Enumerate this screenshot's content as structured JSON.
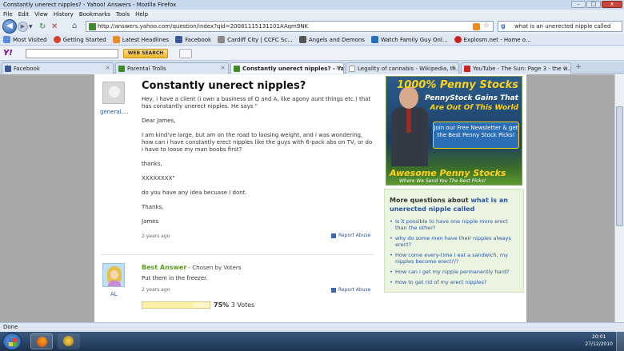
{
  "window": {
    "title": "Constantly unerect nipples? - Yahoo! Answers - Mozilla Firefox",
    "minimize": "–",
    "maximize": "□",
    "close": "x"
  },
  "menu": [
    "File",
    "Edit",
    "View",
    "History",
    "Bookmarks",
    "Tools",
    "Help"
  ],
  "nav": {
    "url": "http://answers.yahoo.com/question/index?qid=20081115131101AAqm9NK",
    "search_value": "what is an unerected nipple called"
  },
  "bookmarks": [
    {
      "label": "Most Visited",
      "color": "#5a8ad8"
    },
    {
      "label": "Getting Started",
      "color": "#d8402a"
    },
    {
      "label": "Latest Headlines",
      "color": "#f28a1a"
    },
    {
      "label": "Facebook",
      "color": "#3b5998"
    },
    {
      "label": "Cardiff City | CCFC Sc...",
      "color": "#888888"
    },
    {
      "label": "Angels and Demons",
      "color": "#555555"
    },
    {
      "label": "Watch Family Guy Onl...",
      "color": "#2a6fb5"
    },
    {
      "label": "Explosm.net - Home o...",
      "color": "#cc2222"
    }
  ],
  "yahoo_toolbar": {
    "logo": "Y!",
    "web_search": "WEB SEARCH"
  },
  "tabs": [
    {
      "label": "Facebook",
      "color": "#3b5998",
      "active": false
    },
    {
      "label": "Parental Trolls",
      "color": "#3f8a2b",
      "active": false
    },
    {
      "label": "Constantly unerect nipples? - Yah...",
      "color": "#3f8a2b",
      "active": true
    },
    {
      "label": "Legality of cannabis - Wikipedia, th...",
      "color": "#ffffff",
      "active": false
    },
    {
      "label": "YouTube - The Sun: Page 3 - the w...",
      "color": "#cc2222",
      "active": false
    }
  ],
  "tab_new": "+",
  "question": {
    "user": "general....",
    "title": "Constantly unerect nipples?",
    "body": [
      "Hey, i have a client (i own a business of Q and A, like agony aunt things etc.) that has constantly unerect nipples. He says \"",
      "Dear James,",
      "I am kind've large, but am on the road to loosing weight, and i was wondering, how can i have constantly erect nipples like the guys with 6-pack abs on TV, or do i have to loose my man boobs first?",
      "thanks,",
      "XXXXXXXX\"",
      "do you have any idea becuase I dont.",
      "Thanks,",
      "James"
    ],
    "time": "2 years ago",
    "report": "Report Abuse"
  },
  "answer": {
    "user": "AL",
    "best_label": "Best Answer",
    "chosen_by": " - Chosen by Voters",
    "body": "Put them in the freezer.",
    "time": "2 years ago",
    "report": "Report Abuse",
    "vote_percent_text": "75%",
    "vote_count_text": "3 Votes",
    "vote_fraction": 0.75
  },
  "ad": {
    "line1": "1000% Penny Stocks",
    "line2": "PennyStock Gains That",
    "line3": "Are Out Of This World",
    "button": "Join our Free Newsletter & get the Best Penny Stock Picks!",
    "logo": "Awesome Penny Stocks",
    "tagline": "Where We Send You The Best Picks!"
  },
  "more_questions": {
    "title_prefix": "More questions about ",
    "title_highlight": "what is an unerected nipple called",
    "items": [
      "Is it possible to have one nipple more erect than the other?",
      "why do some men have their nipples always erect?",
      "How come every-time I eat a sandwich, my nipples become erect?/?",
      "How can i get my nipple permanently hard?",
      "How to get rid of my erect nipples?"
    ]
  },
  "status": "Done",
  "taskbar": {
    "time": "20:01",
    "date": "27/12/2010"
  }
}
